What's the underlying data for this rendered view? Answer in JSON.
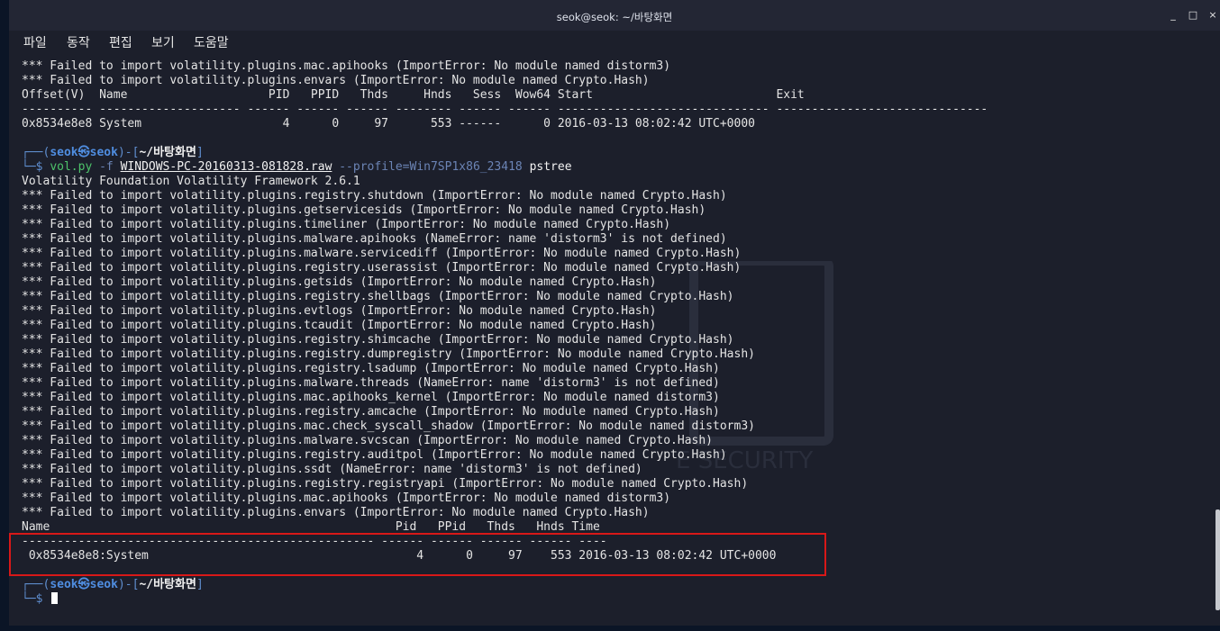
{
  "window": {
    "title": "seok@seok: ~/바탕화면",
    "controls": {
      "minimize": "_",
      "maximize": "□",
      "close": "×"
    }
  },
  "menu": [
    "파일",
    "동작",
    "편집",
    "보기",
    "도움말"
  ],
  "colors": {
    "terminal_bg": "#1c1f2b",
    "text": "#e4e4e4",
    "prompt_user": "#4f8de0",
    "command": "#4dc36a",
    "flag": "#6b84b5",
    "highlight_box": "#d81818"
  },
  "watermark_text": "E SECURITY",
  "output_top": [
    "*** Failed to import volatility.plugins.mac.apihooks (ImportError: No module named distorm3)",
    "*** Failed to import volatility.plugins.envars (ImportError: No module named Crypto.Hash)",
    "Offset(V)  Name                    PID   PPID   Thds     Hnds   Sess  Wow64 Start                          Exit",
    "---------- -------------------- ------ ------ ------ -------- ------ ------ ------------------------------ ------------------------------",
    "0x8534e8e8 System                    4      0     97      553 ------      0 2016-03-13 08:02:42 UTC+0000"
  ],
  "prompt1": {
    "top_left": "┌──(",
    "user": "seok",
    "at": "㉿",
    "host": "seok",
    "mid": ")-[",
    "path": "~/바탕화면",
    "end": "]",
    "bottom_left": "└─$ ",
    "cmd_prog": "vol.py",
    "flag_f": "-f",
    "file": "WINDOWS-PC-20160313-081828.raw",
    "flag_profile": "--profile=Win7SP1x86_23418",
    "plugin": "pstree"
  },
  "output_main": [
    "Volatility Foundation Volatility Framework 2.6.1",
    "*** Failed to import volatility.plugins.registry.shutdown (ImportError: No module named Crypto.Hash)",
    "*** Failed to import volatility.plugins.getservicesids (ImportError: No module named Crypto.Hash)",
    "*** Failed to import volatility.plugins.timeliner (ImportError: No module named Crypto.Hash)",
    "*** Failed to import volatility.plugins.malware.apihooks (NameError: name 'distorm3' is not defined)",
    "*** Failed to import volatility.plugins.malware.servicediff (ImportError: No module named Crypto.Hash)",
    "*** Failed to import volatility.plugins.registry.userassist (ImportError: No module named Crypto.Hash)",
    "*** Failed to import volatility.plugins.getsids (ImportError: No module named Crypto.Hash)",
    "*** Failed to import volatility.plugins.registry.shellbags (ImportError: No module named Crypto.Hash)",
    "*** Failed to import volatility.plugins.evtlogs (ImportError: No module named Crypto.Hash)",
    "*** Failed to import volatility.plugins.tcaudit (ImportError: No module named Crypto.Hash)",
    "*** Failed to import volatility.plugins.registry.shimcache (ImportError: No module named Crypto.Hash)",
    "*** Failed to import volatility.plugins.registry.dumpregistry (ImportError: No module named Crypto.Hash)",
    "*** Failed to import volatility.plugins.registry.lsadump (ImportError: No module named Crypto.Hash)",
    "*** Failed to import volatility.plugins.malware.threads (NameError: name 'distorm3' is not defined)",
    "*** Failed to import volatility.plugins.mac.apihooks_kernel (ImportError: No module named distorm3)",
    "*** Failed to import volatility.plugins.registry.amcache (ImportError: No module named Crypto.Hash)",
    "*** Failed to import volatility.plugins.mac.check_syscall_shadow (ImportError: No module named distorm3)",
    "*** Failed to import volatility.plugins.malware.svcscan (ImportError: No module named Crypto.Hash)",
    "*** Failed to import volatility.plugins.registry.auditpol (ImportError: No module named Crypto.Hash)",
    "*** Failed to import volatility.plugins.ssdt (NameError: name 'distorm3' is not defined)",
    "*** Failed to import volatility.plugins.registry.registryapi (ImportError: No module named Crypto.Hash)",
    "*** Failed to import volatility.plugins.mac.apihooks (ImportError: No module named distorm3)",
    "*** Failed to import volatility.plugins.envars (ImportError: No module named Crypto.Hash)",
    "Name                                                 Pid   PPid   Thds   Hnds Time",
    "-------------------------------------------------- ------ ------ ------ ------ ----",
    " 0x8534e8e8:System                                      4      0     97    553 2016-03-13 08:02:42 UTC+0000"
  ],
  "prompt2": {
    "top_left": "┌──(",
    "user": "seok",
    "at": "㉿",
    "host": "seok",
    "mid": ")-[",
    "path": "~/바탕화면",
    "end": "]",
    "bottom_left": "└─$ "
  }
}
